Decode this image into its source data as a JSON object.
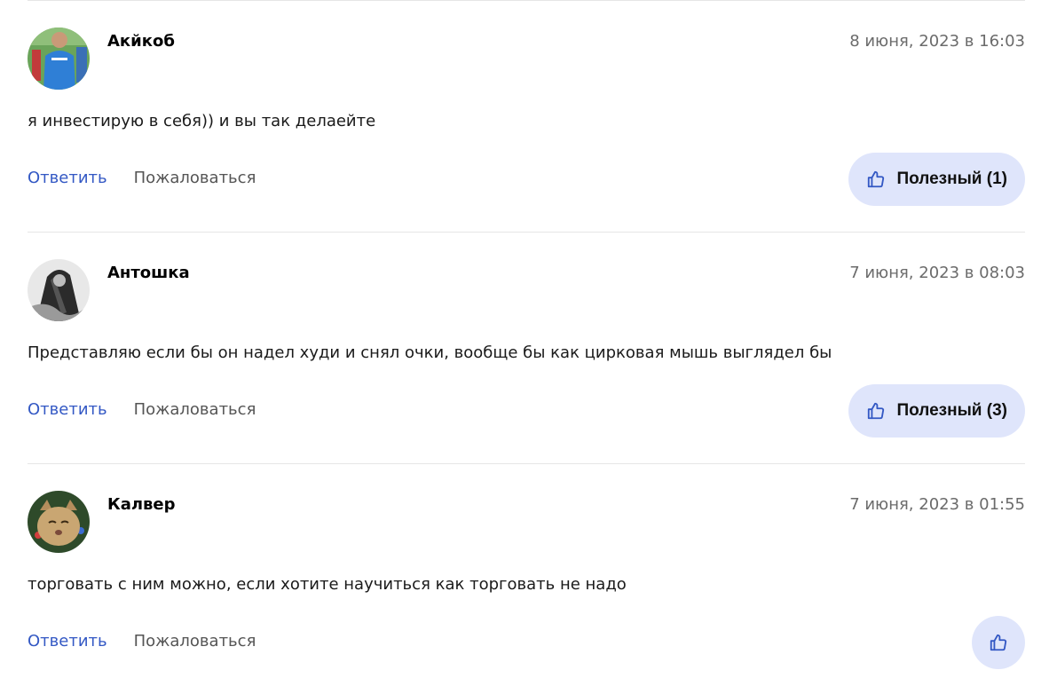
{
  "comments": [
    {
      "author": "Акйкоб",
      "date": "8 июня, 2023 в 16:03",
      "text": "я инвестирую в себя)) и вы так делаейте",
      "reply_label": "Ответить",
      "complain_label": "Пожаловаться",
      "useful_label": "Полезный (1)"
    },
    {
      "author": "Антошка",
      "date": "7 июня, 2023 в 08:03",
      "text": "Представляю если бы он надел худи и снял очки, вообще бы как цирковая мышь выглядел бы",
      "reply_label": "Ответить",
      "complain_label": "Пожаловаться",
      "useful_label": "Полезный (3)"
    },
    {
      "author": "Калвер",
      "date": "7 июня, 2023 в 01:55",
      "text": "торговать с ним можно, если хотите научиться как торговать не надо",
      "reply_label": "Ответить",
      "complain_label": "Пожаловаться",
      "useful_label": ""
    }
  ],
  "icons": {
    "useful": "thumbs-up-icon"
  },
  "colors": {
    "link": "#3358c4",
    "secondary_text": "#555555",
    "date_text": "#6b6b6b",
    "useful_bg": "#dfe5fb",
    "divider": "#e6e6e6",
    "icon": "#3358c4"
  }
}
